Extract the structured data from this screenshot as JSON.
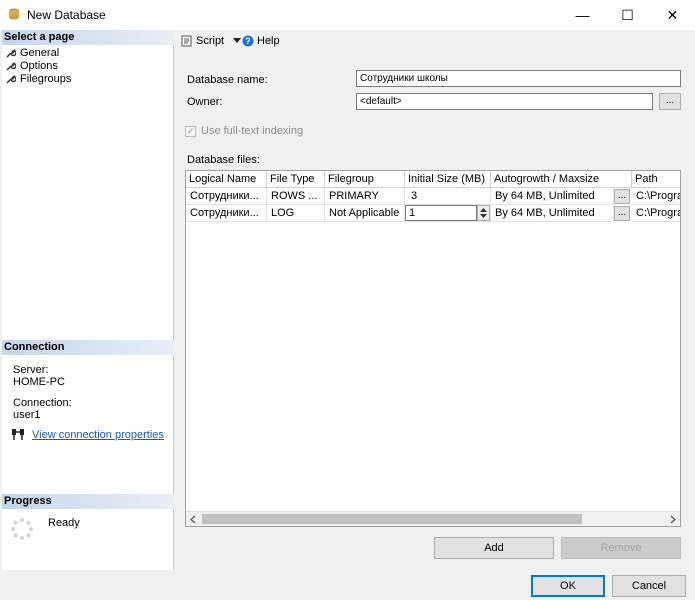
{
  "window": {
    "title": "New Database",
    "minimize": "—",
    "maximize": "☐",
    "close": "✕"
  },
  "left": {
    "select_page_header": "Select a page",
    "pages": [
      "General",
      "Options",
      "Filegroups"
    ],
    "connection_header": "Connection",
    "server_label": "Server:",
    "server_value": "HOME-PC",
    "connection_label": "Connection:",
    "connection_value": "user1",
    "view_props_link": "View connection properties",
    "progress_header": "Progress",
    "progress_status": "Ready"
  },
  "toolbar": {
    "script_label": "Script",
    "help_label": "Help"
  },
  "form": {
    "db_name_label": "Database name:",
    "db_name_value": "Сотрудники школы",
    "owner_label": "Owner:",
    "owner_value": "<default>",
    "owner_browse": "...",
    "fulltext_label": "Use full-text indexing",
    "fulltext_checked": true,
    "db_files_label": "Database files:"
  },
  "grid": {
    "columns": [
      "Logical Name",
      "File Type",
      "Filegroup",
      "Initial Size (MB)",
      "Autogrowth / Maxsize",
      "Path"
    ],
    "rows": [
      [
        "Сотрудники...",
        "ROWS ...",
        "PRIMARY",
        "3",
        "By 64 MB, Unlimited",
        "C:\\Progra"
      ],
      [
        "Сотрудники...",
        "LOG",
        "Not Applicable",
        "1",
        "By 64 MB, Unlimited",
        "C:\\Progra"
      ]
    ],
    "cell_browse": "..."
  },
  "buttons": {
    "add": "Add",
    "remove": "Remove",
    "ok": "OK",
    "cancel": "Cancel"
  },
  "colors": {
    "accent": "#0078d7",
    "link": "#1a56c9",
    "header_gradient_start": "#c5d6ea"
  }
}
